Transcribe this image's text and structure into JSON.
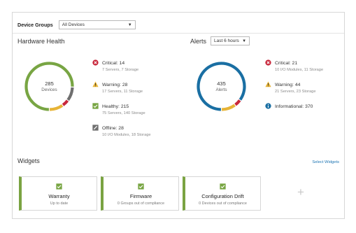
{
  "device_groups": {
    "label": "Device Groups",
    "selected": "All Devices"
  },
  "hardware_health": {
    "title": "Hardware Health",
    "total": "285",
    "total_label": "Devices",
    "segments": [
      {
        "name": "Healthy",
        "value": 215,
        "color": "#78a543"
      },
      {
        "name": "Offline",
        "value": 28,
        "color": "#6f6f6f"
      },
      {
        "name": "Critical",
        "value": 14,
        "color": "#c8283c"
      },
      {
        "name": "Warning",
        "value": 28,
        "color": "#e7b437"
      }
    ],
    "items": [
      {
        "icon": "critical-icon",
        "title": "Critical: 14",
        "sub": "7 Servers, 7 Storage"
      },
      {
        "icon": "warning-icon",
        "title": "Warning: 28",
        "sub": "17 Servers, 11 Storage"
      },
      {
        "icon": "healthy-icon",
        "title": "Healthy: 215",
        "sub": "75 Servers, 140 Storage"
      },
      {
        "icon": "offline-icon",
        "title": "Offline: 28",
        "sub": "10 I/O Modules, 18 Storage"
      }
    ]
  },
  "alerts": {
    "title": "Alerts",
    "range": "Last 6 hours",
    "total": "435",
    "total_label": "Alerts",
    "segments": [
      {
        "name": "Informational",
        "value": 370,
        "color": "#1a6fa3"
      },
      {
        "name": "Critical",
        "value": 21,
        "color": "#c8283c"
      },
      {
        "name": "Warning",
        "value": 44,
        "color": "#e7b437"
      }
    ],
    "items": [
      {
        "icon": "critical-icon",
        "title": "Critical: 21",
        "sub": "10 I/O Modules, 11 Storage"
      },
      {
        "icon": "warning-icon",
        "title": "Warning: 44",
        "sub": "21 Servers, 23 Storage"
      },
      {
        "icon": "info-icon",
        "title": "Informational: 370",
        "sub": ""
      }
    ]
  },
  "widgets": {
    "title": "Widgets",
    "select_link": "Select Widgets",
    "add_label": "+",
    "cards": [
      {
        "title": "Warranty",
        "sub": "Up to date"
      },
      {
        "title": "Firmware",
        "sub": "0 Groups out of compliance"
      },
      {
        "title": "Configuration Drift",
        "sub": "0 Devices out of compliance"
      }
    ]
  },
  "colors": {
    "green": "#78a543",
    "red": "#c8283c",
    "yellow": "#e7b437",
    "blue": "#1a6fa3",
    "gray": "#6f6f6f",
    "link": "#1d75b3"
  }
}
